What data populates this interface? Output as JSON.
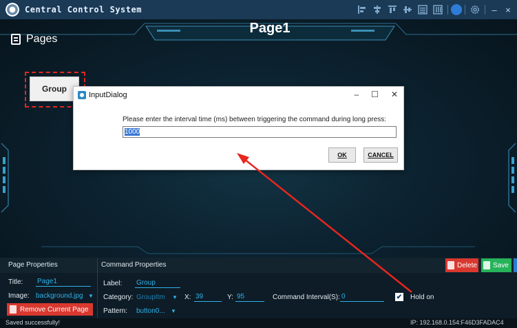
{
  "window": {
    "title": "Central Control System",
    "controls": {
      "minimize": "–",
      "close": "×"
    }
  },
  "toolbar_icons": [
    "align-left-icon",
    "align-center-icon",
    "align-top-icon",
    "align-middle-icon",
    "list-icon",
    "grid-icon",
    "status-dot-icon",
    "settings-icon"
  ],
  "canvas": {
    "pages_label": "Pages",
    "page_title": "Page1",
    "group_button_label": "Group"
  },
  "dialog": {
    "title": "InputDialog",
    "prompt": "Please enter the interval time (ms) between triggering the command during long press:",
    "input_value": "1000",
    "ok_label": "OK",
    "cancel_label": "CANCEL",
    "controls": {
      "minimize": "–",
      "maximize": "☐",
      "close": "✕"
    }
  },
  "page_properties": {
    "section_title": "Page Properties",
    "title_label": "Title:",
    "title_value": "Page1",
    "image_label": "Image:",
    "image_value": "background.jpg",
    "remove_label": "Remove Current Page"
  },
  "command_properties": {
    "section_title": "Command Properties",
    "label_label": "Label:",
    "label_value": "Group",
    "category_label": "Category:",
    "category_value": "GroupItm",
    "x_label": "X:",
    "x_value": "39",
    "y_label": "Y:",
    "y_value": "95",
    "interval_label": "Command Interval(S):",
    "interval_value": "0",
    "hold_label": "Hold on",
    "hold_checked": true,
    "pattern_label": "Pattern:",
    "pattern_value": "button0..."
  },
  "actions": {
    "delete_label": "Delete",
    "save_label": "Save"
  },
  "status": {
    "message": "Saved successfully!",
    "ip": "IP: 192.168.0.154:F46D3FADAC4"
  },
  "colors": {
    "accent_blue": "#2fb2ea",
    "delete_red": "#d9382f",
    "save_green": "#26b35a",
    "annotation_red": "#e8261f"
  }
}
